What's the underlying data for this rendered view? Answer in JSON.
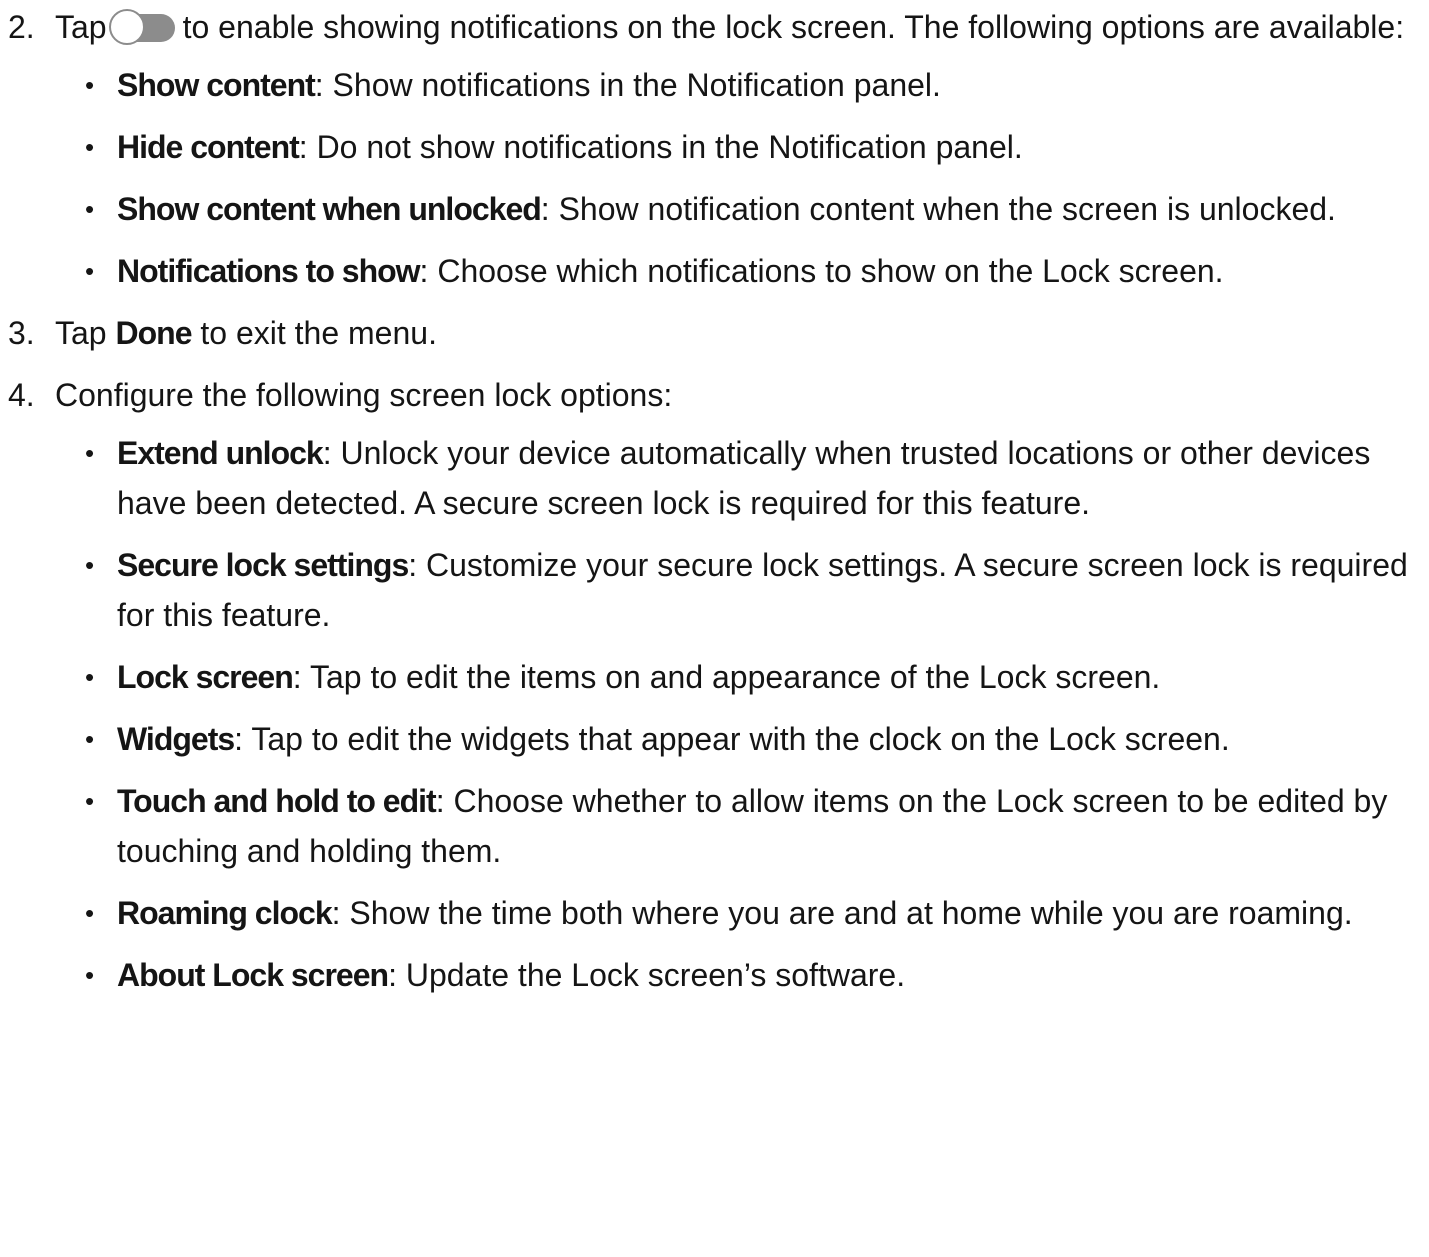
{
  "steps": [
    {
      "number": "2.",
      "text_before": "Tap",
      "toggle_icon": "toggle-off-icon",
      "text_after": "to enable showing notifications on the lock screen. The following options are available:",
      "bullets": [
        {
          "term": "Show content",
          "desc": ": Show notifications in the Notification panel."
        },
        {
          "term": "Hide content",
          "desc": ": Do not show notifications in the Notification panel."
        },
        {
          "term": "Show content when unlocked",
          "desc": ": Show notification content when the screen is unlocked."
        },
        {
          "term": "Notifications to show",
          "desc": ": Choose which notifications to show on the Lock screen."
        }
      ]
    },
    {
      "number": "3.",
      "text_before": "Tap",
      "bold": "Done",
      "text_after": "to exit the menu."
    },
    {
      "number": "4.",
      "text": "Configure the following screen lock options:",
      "bullets": [
        {
          "term": "Extend unlock",
          "desc": ": Unlock your device automatically when trusted locations or other devices have been detected. A secure screen lock is required for this feature."
        },
        {
          "term": "Secure lock settings",
          "desc": ": Customize your secure lock settings. A secure screen lock is required for this feature."
        },
        {
          "term": "Lock screen",
          "desc": ": Tap to edit the items on and appearance of the Lock screen."
        },
        {
          "term": "Widgets",
          "desc": ": Tap to edit the widgets that appear with the clock on the Lock screen."
        },
        {
          "term": "Touch and hold to edit",
          "desc": ": Choose whether to allow items on the Lock screen to be edited by touching and holding them."
        },
        {
          "term": "Roaming clock",
          "desc": ": Show the time both where you are and at home while you are roaming."
        },
        {
          "term": "About Lock screen",
          "desc": ": Update the Lock screen’s software."
        }
      ]
    }
  ],
  "bullet_glyph": "•"
}
